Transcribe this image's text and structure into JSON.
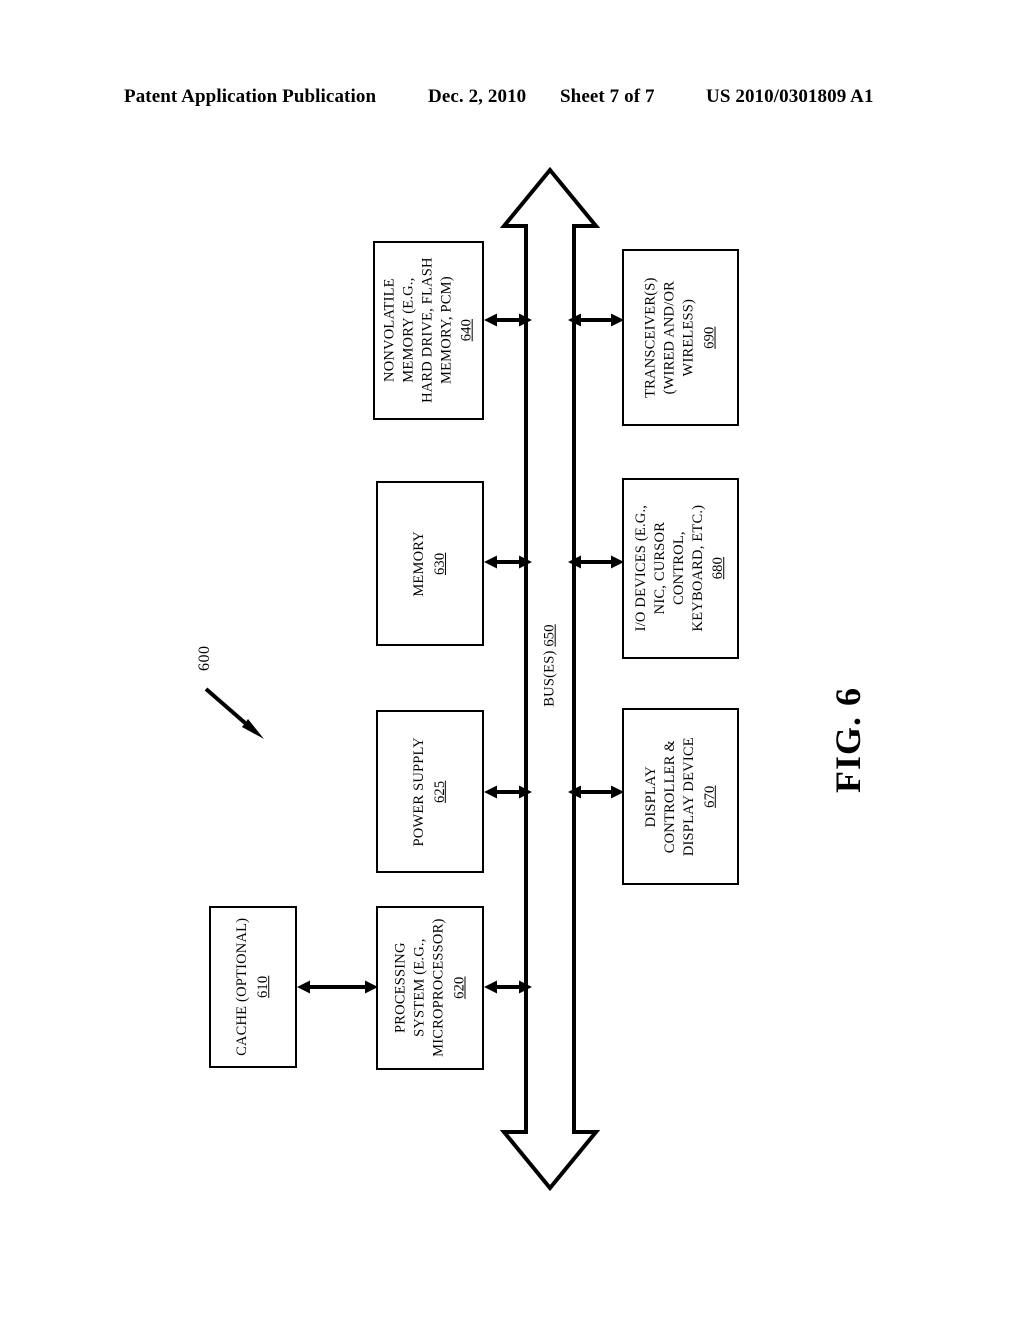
{
  "header": {
    "publication": "Patent Application Publication",
    "date": "Dec. 2, 2010",
    "sheet": "Sheet 7 of 7",
    "patent_number": "US 2010/0301809 A1"
  },
  "figure": {
    "caption": "FIG. 6",
    "system_reference": "600"
  },
  "bus": {
    "label": "BUS(ES)",
    "ref": "650"
  },
  "blocks": [
    {
      "id": "nonvolatile-memory",
      "lines": [
        "NONVOLATILE",
        "MEMORY (E.G.,",
        "HARD DRIVE, FLASH",
        "MEMORY, PCM)"
      ],
      "ref": "640"
    },
    {
      "id": "transceivers",
      "lines": [
        "TRANSCEIVER(S)",
        "(WIRED AND/OR",
        "WIRELESS)"
      ],
      "ref": "690"
    },
    {
      "id": "memory",
      "lines": [
        "MEMORY"
      ],
      "ref": "630"
    },
    {
      "id": "io-devices",
      "lines": [
        "I/O DEVICES (E.G.,",
        "NIC, CURSOR",
        "CONTROL,",
        "KEYBOARD, ETC.)"
      ],
      "ref": "680"
    },
    {
      "id": "power-supply",
      "lines": [
        "POWER SUPPLY"
      ],
      "ref": "625"
    },
    {
      "id": "display-controller",
      "lines": [
        "DISPLAY",
        "CONTROLLER &",
        "DISPLAY DEVICE"
      ],
      "ref": "670"
    },
    {
      "id": "cache",
      "lines": [
        "CACHE (OPTIONAL)"
      ],
      "ref": "610"
    },
    {
      "id": "processing-system",
      "lines": [
        "PROCESSING",
        "SYSTEM (E.G.,",
        "MICROPROCESSOR)"
      ],
      "ref": "620"
    }
  ],
  "connections": [
    {
      "id": "nonvolatile-memory-to-bus",
      "from": "640",
      "to": "650",
      "style": "double-arrow"
    },
    {
      "id": "bus-to-transceivers",
      "from": "650",
      "to": "690",
      "style": "double-arrow"
    },
    {
      "id": "memory-to-bus",
      "from": "630",
      "to": "650",
      "style": "double-arrow"
    },
    {
      "id": "bus-to-io-devices",
      "from": "650",
      "to": "680",
      "style": "double-arrow"
    },
    {
      "id": "power-supply-to-bus",
      "from": "625",
      "to": "650",
      "style": "double-arrow"
    },
    {
      "id": "bus-to-display-controller",
      "from": "650",
      "to": "670",
      "style": "double-arrow"
    },
    {
      "id": "cache-to-processing-system",
      "from": "610",
      "to": "620",
      "style": "double-arrow"
    },
    {
      "id": "processing-system-to-bus",
      "from": "620",
      "to": "650",
      "style": "double-arrow"
    }
  ],
  "colors": {
    "ink": "#000000",
    "page": "#ffffff"
  }
}
